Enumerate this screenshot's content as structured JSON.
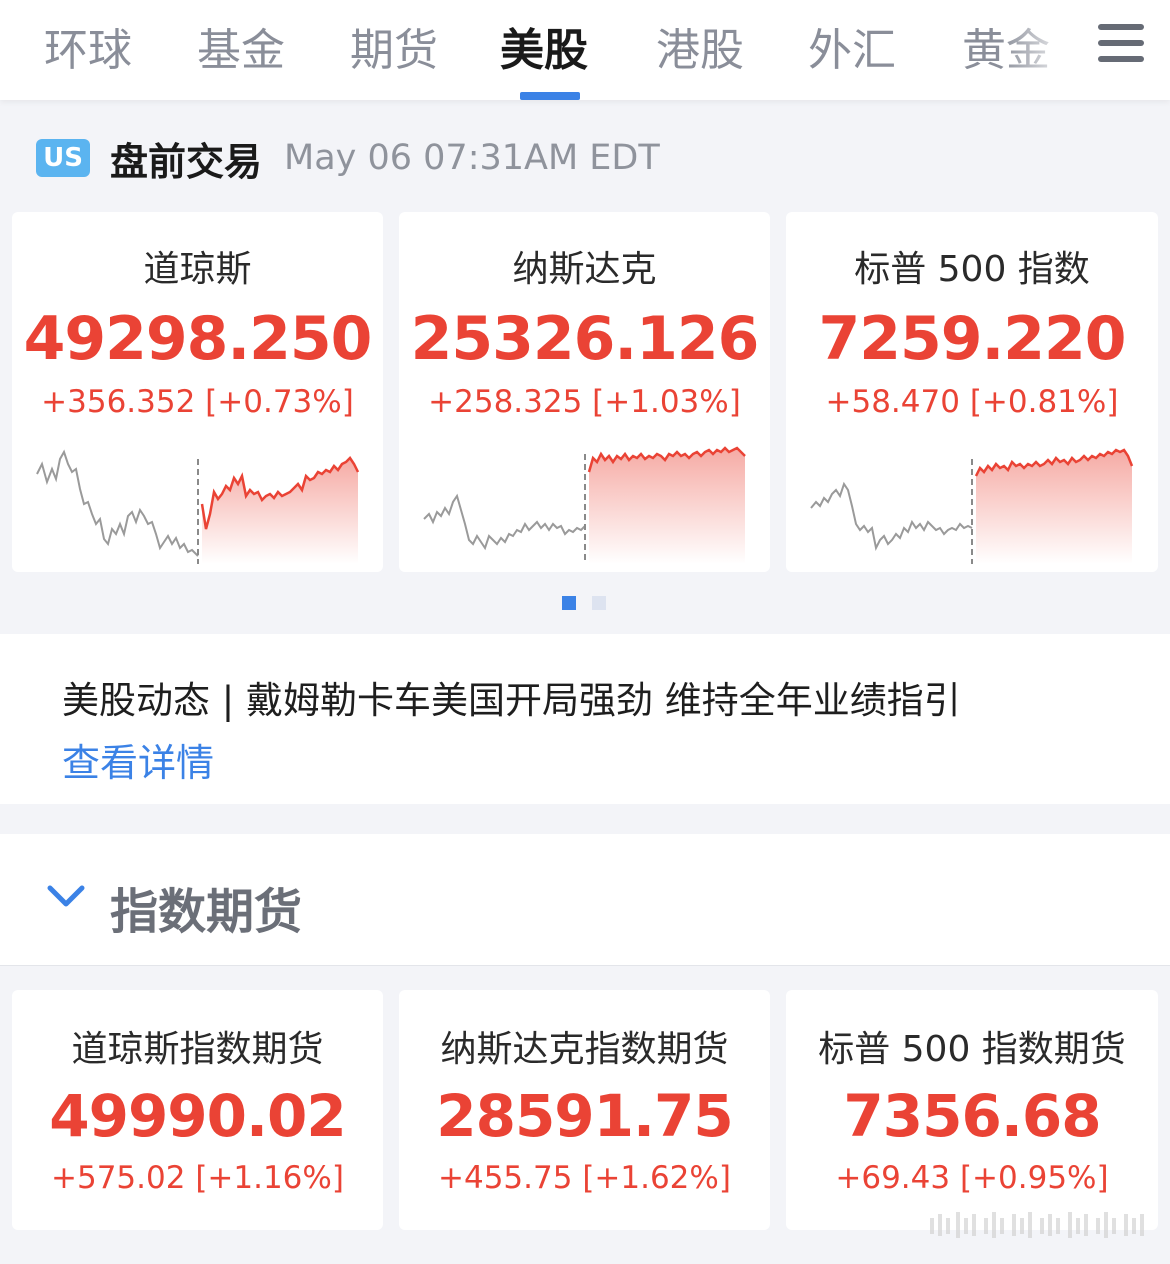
{
  "tabs": [
    {
      "label": "环球"
    },
    {
      "label": "基金"
    },
    {
      "label": "期货"
    },
    {
      "label": "美股"
    },
    {
      "label": "港股"
    },
    {
      "label": "外汇"
    },
    {
      "label": "黄金"
    }
  ],
  "active_tab": "美股",
  "icons": {
    "menu": "menu-icon",
    "collapse": "chevron-down-icon"
  },
  "colors": {
    "up": "#ea4335",
    "accent": "#3b82e6",
    "badge": "#5bb4f0"
  },
  "market": {
    "badge": "US",
    "title": "盘前交易",
    "time": "May 06 07:31AM EDT"
  },
  "indices": [
    {
      "name": "道琼斯",
      "price": "49298.250",
      "change": "+356.352 [+0.73%]"
    },
    {
      "name": "纳斯达克",
      "price": "25326.126",
      "change": "+258.325 [+1.03%]"
    },
    {
      "name": "标普 500 指数",
      "price": "7259.220",
      "change": "+58.470 [+0.81%]"
    }
  ],
  "carousel": {
    "pages": 2,
    "current": 1
  },
  "news": {
    "text": "美股动态 | 戴姆勒卡车美国开局强劲 维持全年业绩指引",
    "link": "查看详情"
  },
  "futures_section": {
    "title": "指数期货"
  },
  "futures": [
    {
      "name": "道琼斯指数期货",
      "price": "49990.02",
      "change": "+575.02 [+1.16%]"
    },
    {
      "name": "纳斯达克指数期货",
      "price": "28591.75",
      "change": "+455.75 [+1.62%]"
    },
    {
      "name": "标普 500 指数期货",
      "price": "7356.68",
      "change": "+69.43 [+0.95%]"
    }
  ]
}
